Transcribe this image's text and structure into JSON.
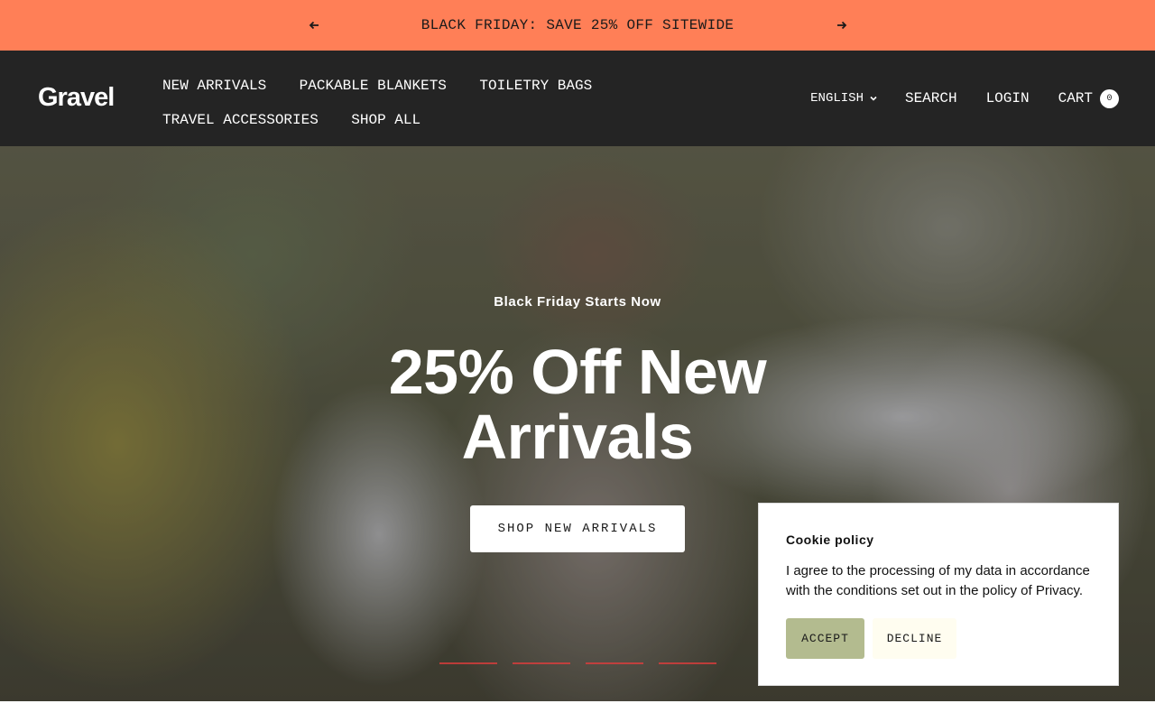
{
  "announcement": {
    "text": "BLACK FRIDAY: SAVE 25% OFF SITEWIDE",
    "prev_icon": "arrow-left-icon",
    "next_icon": "arrow-right-icon",
    "background": "#ff7f57"
  },
  "header": {
    "logo": "Gravel",
    "background": "#242424",
    "nav": [
      {
        "label": "NEW ARRIVALS"
      },
      {
        "label": "PACKABLE BLANKETS"
      },
      {
        "label": "TOILETRY BAGS"
      },
      {
        "label": "TRAVEL ACCESSORIES"
      },
      {
        "label": "SHOP ALL"
      }
    ],
    "language": "ENGLISH",
    "search_label": "SEARCH",
    "login_label": "LOGIN",
    "cart_label": "CART",
    "cart_count": "0"
  },
  "hero": {
    "eyebrow": "Black Friday Starts Now",
    "headline": "25% Off New Arrivals",
    "cta_label": "SHOP NEW ARRIVALS",
    "slide_count": 4
  },
  "cookie": {
    "title": "Cookie policy",
    "text": "I agree to the processing of my data in accordance with the conditions set out in the policy of Privacy.",
    "accept_label": "ACCEPT",
    "decline_label": "DECLINE",
    "accept_color": "#b3bb8f"
  }
}
